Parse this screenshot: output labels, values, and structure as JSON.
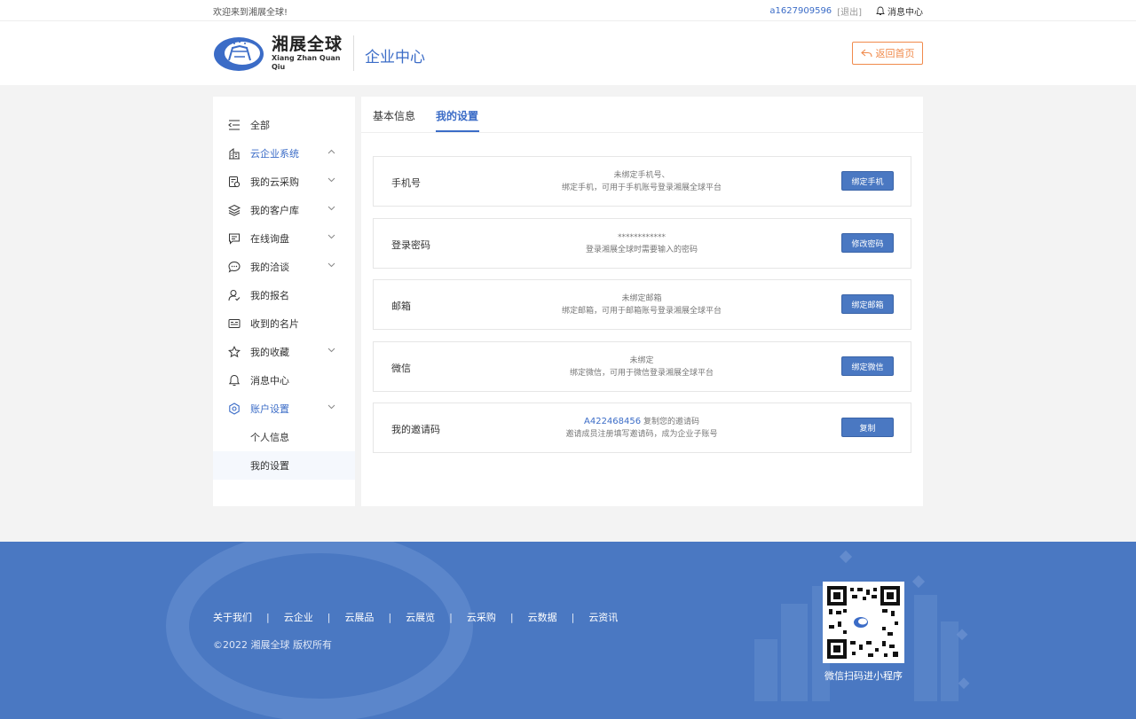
{
  "topbar": {
    "welcome": "欢迎来到湘展全球!",
    "username": "a1627909596",
    "logout": "[退出]",
    "messages": "消息中心"
  },
  "header": {
    "logo_cn": "湘展全球",
    "logo_en": "Xiang Zhan Quan Qiu",
    "center_title": "企业中心",
    "back_label": "返回首页"
  },
  "sidebar": {
    "items": [
      {
        "label": "全部",
        "icon": "menu-collapse-icon"
      },
      {
        "label": "云企业系统",
        "icon": "building-icon"
      },
      {
        "label": "我的云采购",
        "icon": "purchase-icon"
      },
      {
        "label": "我的客户库",
        "icon": "layers-icon"
      },
      {
        "label": "在线询盘",
        "icon": "inquiry-icon"
      },
      {
        "label": "我的洽谈",
        "icon": "chat-icon"
      },
      {
        "label": "我的报名",
        "icon": "user-register-icon"
      },
      {
        "label": "收到的名片",
        "icon": "card-icon"
      },
      {
        "label": "我的收藏",
        "icon": "star-icon"
      },
      {
        "label": "消息中心",
        "icon": "bell-icon"
      },
      {
        "label": "账户设置",
        "icon": "settings-icon"
      }
    ],
    "sub_items": [
      {
        "label": "个人信息"
      },
      {
        "label": "我的设置"
      }
    ]
  },
  "tabs": [
    {
      "label": "基本信息"
    },
    {
      "label": "我的设置"
    }
  ],
  "settings": [
    {
      "label": "手机号",
      "line1": "未绑定手机号、",
      "line2": "绑定手机，可用于手机账号登录湘展全球平台",
      "button": "绑定手机"
    },
    {
      "label": "登录密码",
      "line1": "************",
      "line2": "登录湘展全球时需要输入的密码",
      "button": "修改密码"
    },
    {
      "label": "邮箱",
      "line1": "未绑定邮箱",
      "line2": "绑定邮箱，可用于邮箱账号登录湘展全球平台",
      "button": "绑定邮箱"
    },
    {
      "label": "微信",
      "line1": "未绑定",
      "line2": "绑定微信，可用于微信登录湘展全球平台",
      "button": "绑定微信"
    },
    {
      "label": "我的邀请码",
      "code": "A422468456",
      "line1": "复制您的邀请码",
      "line2": "邀请成员注册填写邀请码，成为企业子账号",
      "button": "复制"
    }
  ],
  "footer": {
    "links": [
      "关于我们",
      "云企业",
      "云展品",
      "云展览",
      "云采购",
      "云数据",
      "云资讯"
    ],
    "separator": "|",
    "copyright": "©2022 湘展全球 版权所有",
    "qr_caption": "微信扫码进小程序"
  },
  "colors": {
    "accent": "#3b6cc7",
    "button": "#4a78c2",
    "back_button": "#f08a4b",
    "footer_bg": "#4a78c2"
  }
}
